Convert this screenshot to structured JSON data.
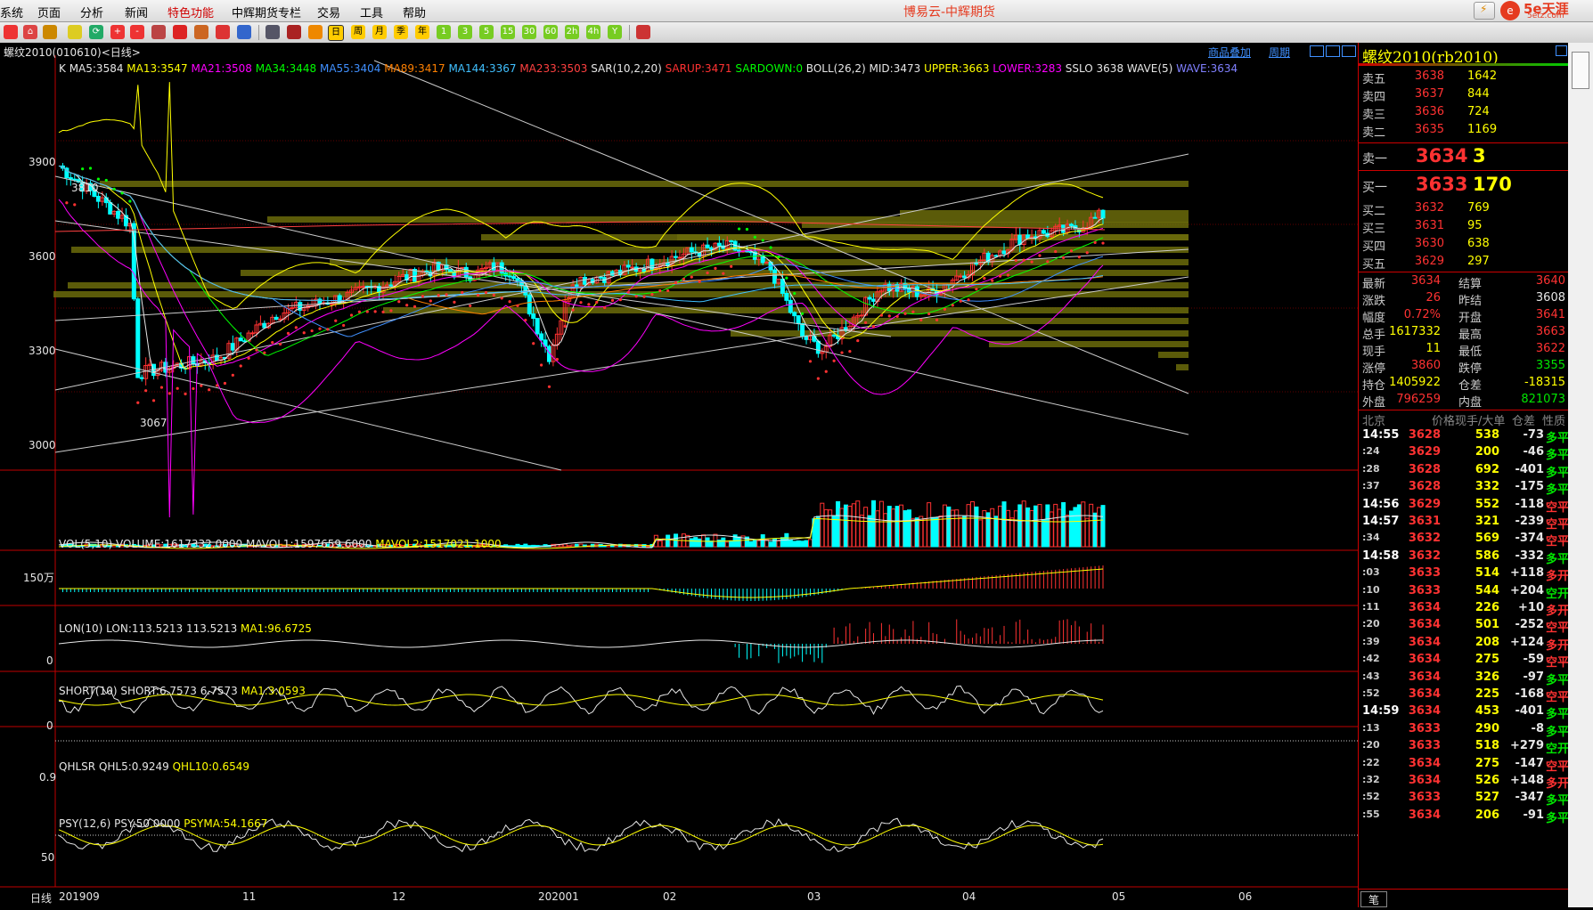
{
  "menu": {
    "items": [
      "系统",
      "页面",
      "分析",
      "新闻",
      "特色功能",
      "中辉期货专栏",
      "交易",
      "工具",
      "帮助"
    ],
    "window_title": "博易云-中辉期货",
    "logo_text": "5e天涯",
    "logo_url": "5etz.com"
  },
  "toolbar": {
    "buttons": [
      "home-icon",
      "book-icon",
      "refresh-icon",
      "zoom-in-icon",
      "zoom-out-icon",
      "window-icon",
      "pen-icon",
      "trend-icon",
      "filter-icon",
      "compass-icon",
      "grid-icon",
      "line-chart-icon",
      "tick-icon",
      "calendar-icon",
      "week-label",
      "month-label",
      "season-label",
      "year-label",
      "1",
      "3",
      "5",
      "15",
      "30",
      "60",
      "2h",
      "4h",
      "Y"
    ],
    "period_labels": [
      "周",
      "月",
      "季",
      "年",
      "1",
      "3",
      "5",
      "15",
      "30",
      "60",
      "2h",
      "4h",
      "Y"
    ]
  },
  "chart_header": {
    "instrument": "螺纹2010(010610)<日线>",
    "link_overlay": "商品叠加",
    "link_period": "周期",
    "indicator_line": [
      {
        "t": "K",
        "c": "#e6e6e6"
      },
      {
        "t": "MA5:3584",
        "c": "#e6e6e6"
      },
      {
        "t": "MA13:3547",
        "c": "#ffff00"
      },
      {
        "t": "MA21:3508",
        "c": "#ff00ff"
      },
      {
        "t": "MA34:3448",
        "c": "#00ff00"
      },
      {
        "t": "MA55:3404",
        "c": "#4090ff"
      },
      {
        "t": "MA89:3417",
        "c": "#ff8000"
      },
      {
        "t": "MA144:3367",
        "c": "#40c0ff"
      },
      {
        "t": "MA233:3503",
        "c": "#ff4040"
      },
      {
        "t": "SAR(10,2,20)",
        "c": "#e6e6e6"
      },
      {
        "t": "SARUP:3471",
        "c": "#ff3232"
      },
      {
        "t": "SARDOWN:0",
        "c": "#00ff00"
      },
      {
        "t": "BOLL(26,2)",
        "c": "#e6e6e6"
      },
      {
        "t": "MID:3473",
        "c": "#e6e6e6"
      },
      {
        "t": "UPPER:3663",
        "c": "#ffff00"
      },
      {
        "t": "LOWER:3283",
        "c": "#ff00ff"
      },
      {
        "t": "SSLO 3638",
        "c": "#e6e6e6"
      },
      {
        "t": "WAVE(5)",
        "c": "#e6e6e6"
      },
      {
        "t": "WAVE:3634",
        "c": "#8080ff"
      }
    ]
  },
  "price_axis": [
    "3900",
    "3600",
    "3300",
    "3000"
  ],
  "price_marks": {
    "high": "3810",
    "low": "3067"
  },
  "volume_panel": {
    "label": "VOL(5,10)",
    "volume": "VOLUME:1617332.0000",
    "mavol1": "MAVOL1:1597659.6000",
    "mavol2": "MAVOL2:1517021.1000",
    "axis": "150万"
  },
  "lon_panel": {
    "label": "LON(10)",
    "value": "LON:113.5213",
    "value2": "113.5213",
    "ma": "MA1:96.6725",
    "axis": "0"
  },
  "short_panel": {
    "label": "SHORT(10)",
    "value": "SHORT:6.7573",
    "value2": "6.7573",
    "ma": "MA1:3.0593",
    "axis": "0"
  },
  "qhlsr_panel": {
    "label": "QHLSR",
    "v1": "QHL5:0.9249",
    "v2": "QHL10:0.6549",
    "axis": "0.9"
  },
  "psy_panel": {
    "label": "PSY(12,6)",
    "v1": "PSY:50.0000",
    "v2": "PSYMA:54.1667",
    "axis": "50"
  },
  "x_axis": {
    "period": "日线",
    "labels": [
      "201909",
      "11",
      "12",
      "202001",
      "02",
      "03",
      "04",
      "05",
      "06"
    ]
  },
  "quote": {
    "title": "螺纹2010(rb2010)",
    "asks": [
      {
        "label": "卖五",
        "price": "3638",
        "vol": "1642"
      },
      {
        "label": "卖四",
        "price": "3637",
        "vol": "844"
      },
      {
        "label": "卖三",
        "price": "3636",
        "vol": "724"
      },
      {
        "label": "卖二",
        "price": "3635",
        "vol": "1169"
      }
    ],
    "ask1": {
      "label": "卖一",
      "price": "3634",
      "vol": "3"
    },
    "bid1": {
      "label": "买一",
      "price": "3633",
      "vol": "170"
    },
    "bids": [
      {
        "label": "买二",
        "price": "3632",
        "vol": "769"
      },
      {
        "label": "买三",
        "price": "3631",
        "vol": "95"
      },
      {
        "label": "买四",
        "price": "3630",
        "vol": "638"
      },
      {
        "label": "买五",
        "price": "3629",
        "vol": "297"
      }
    ],
    "stats": [
      {
        "l1": "最新",
        "v1": "3634",
        "c1": "red",
        "l2": "结算",
        "v2": "3640",
        "c2": "red"
      },
      {
        "l1": "涨跌",
        "v1": "26",
        "c1": "red",
        "l2": "昨结",
        "v2": "3608",
        "c2": "wht"
      },
      {
        "l1": "幅度",
        "v1": "0.72%",
        "c1": "red",
        "l2": "开盘",
        "v2": "3641",
        "c2": "red"
      },
      {
        "l1": "总手",
        "v1": "1617332",
        "c1": "ylw",
        "l2": "最高",
        "v2": "3663",
        "c2": "red"
      },
      {
        "l1": "现手",
        "v1": "11",
        "c1": "ylw",
        "l2": "最低",
        "v2": "3622",
        "c2": "red"
      },
      {
        "l1": "涨停",
        "v1": "3860",
        "c1": "red",
        "l2": "跌停",
        "v2": "3355",
        "c2": "grn"
      },
      {
        "l1": "持仓",
        "v1": "1405922",
        "c1": "ylw",
        "l2": "仓差",
        "v2": "-18315",
        "c2": "ylw"
      },
      {
        "l1": "外盘",
        "v1": "796259",
        "c1": "red",
        "l2": "内盘",
        "v2": "821073",
        "c2": "grn"
      }
    ],
    "tick_header": {
      "time": "北京",
      "price": "价格",
      "vol": "现手/大单",
      "oi": "仓差",
      "nature": "性质"
    },
    "ticks": [
      {
        "t": "14:55",
        "p": "3628",
        "v": "538",
        "oi": "-73",
        "n": "多平",
        "nc": "grn"
      },
      {
        "t": ":24",
        "p": "3629",
        "v": "200",
        "oi": "-46",
        "n": "多平",
        "nc": "grn"
      },
      {
        "t": ":28",
        "p": "3628",
        "v": "692",
        "oi": "-401",
        "n": "多平",
        "nc": "grn"
      },
      {
        "t": ":37",
        "p": "3628",
        "v": "332",
        "oi": "-175",
        "n": "多平",
        "nc": "grn"
      },
      {
        "t": "14:56",
        "p": "3629",
        "v": "552",
        "oi": "-118",
        "n": "空平",
        "nc": "red"
      },
      {
        "t": "14:57",
        "p": "3631",
        "v": "321",
        "oi": "-239",
        "n": "空平",
        "nc": "red"
      },
      {
        "t": ":34",
        "p": "3632",
        "v": "569",
        "oi": "-374",
        "n": "空平",
        "nc": "red"
      },
      {
        "t": "14:58",
        "p": "3632",
        "v": "586",
        "oi": "-332",
        "n": "多平",
        "nc": "grn"
      },
      {
        "t": ":03",
        "p": "3633",
        "v": "514",
        "oi": "+118",
        "n": "多开",
        "nc": "red"
      },
      {
        "t": ":10",
        "p": "3633",
        "v": "544",
        "oi": "+204",
        "n": "空开",
        "nc": "grn"
      },
      {
        "t": ":11",
        "p": "3634",
        "v": "226",
        "oi": "+10",
        "n": "多开",
        "nc": "red"
      },
      {
        "t": ":20",
        "p": "3634",
        "v": "501",
        "oi": "-252",
        "n": "空平",
        "nc": "red"
      },
      {
        "t": ":39",
        "p": "3634",
        "v": "208",
        "oi": "+124",
        "n": "多开",
        "nc": "red"
      },
      {
        "t": ":42",
        "p": "3634",
        "v": "275",
        "oi": "-59",
        "n": "空平",
        "nc": "red"
      },
      {
        "t": ":43",
        "p": "3634",
        "v": "326",
        "oi": "-97",
        "n": "多平",
        "nc": "grn"
      },
      {
        "t": ":52",
        "p": "3634",
        "v": "225",
        "oi": "-168",
        "n": "空平",
        "nc": "red"
      },
      {
        "t": "14:59",
        "p": "3634",
        "v": "453",
        "oi": "-401",
        "n": "多平",
        "nc": "grn"
      },
      {
        "t": ":13",
        "p": "3633",
        "v": "290",
        "oi": "-8",
        "n": "多平",
        "nc": "grn"
      },
      {
        "t": ":20",
        "p": "3633",
        "v": "518",
        "oi": "+279",
        "n": "空开",
        "nc": "grn"
      },
      {
        "t": ":22",
        "p": "3634",
        "v": "275",
        "oi": "-147",
        "n": "空平",
        "nc": "red"
      },
      {
        "t": ":32",
        "p": "3634",
        "v": "526",
        "oi": "+148",
        "n": "多开",
        "nc": "red"
      },
      {
        "t": ":52",
        "p": "3633",
        "v": "527",
        "oi": "-347",
        "n": "多平",
        "nc": "grn"
      },
      {
        "t": ":55",
        "p": "3634",
        "v": "206",
        "oi": "-91",
        "n": "多平",
        "nc": "grn"
      }
    ],
    "bottom_tab": "笔"
  },
  "colors": {
    "up": "#ff3232",
    "down": "#00ffff",
    "grid": "#800000",
    "panel_border": "#c00000"
  }
}
